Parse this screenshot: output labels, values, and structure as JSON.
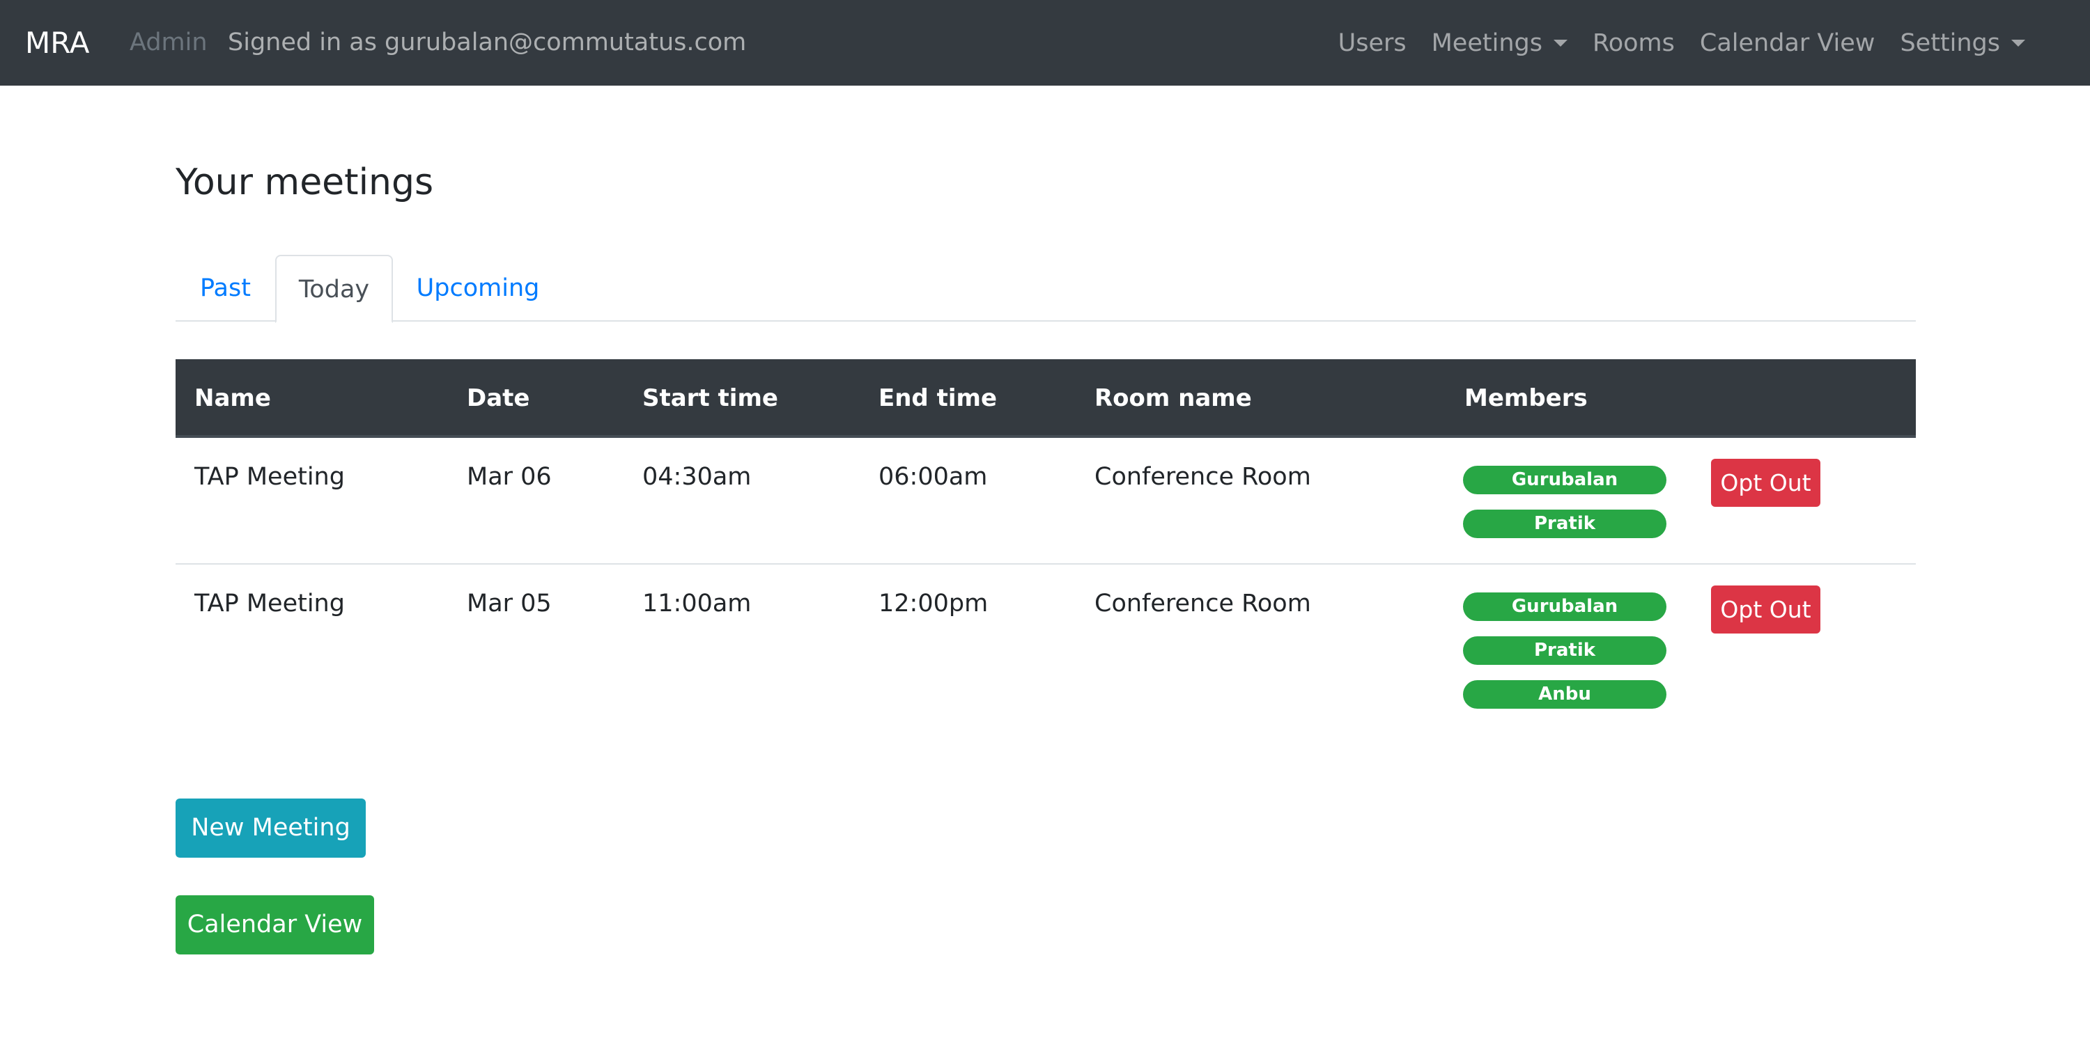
{
  "navbar": {
    "brand": "MRA",
    "admin_label": "Admin",
    "signed_in": "Signed in as gurubalan@commutatus.com",
    "links": {
      "users": "Users",
      "meetings": "Meetings",
      "rooms": "Rooms",
      "calendar_view": "Calendar View",
      "settings": "Settings"
    }
  },
  "page": {
    "title": "Your meetings"
  },
  "tabs": {
    "past": "Past",
    "today": "Today",
    "upcoming": "Upcoming",
    "active": "Today"
  },
  "table": {
    "headers": {
      "name": "Name",
      "date": "Date",
      "start": "Start time",
      "end": "End time",
      "room": "Room name",
      "members": "Members"
    },
    "rows": [
      {
        "name": "TAP Meeting",
        "date": "Mar 06",
        "start": "04:30am",
        "end": "06:00am",
        "room": "Conference Room",
        "members": [
          "Gurubalan",
          "Pratik"
        ],
        "action": "Opt Out"
      },
      {
        "name": "TAP Meeting",
        "date": "Mar 05",
        "start": "11:00am",
        "end": "12:00pm",
        "room": "Conference Room",
        "members": [
          "Gurubalan",
          "Pratik",
          "Anbu"
        ],
        "action": "Opt Out"
      }
    ]
  },
  "buttons": {
    "new_meeting": "New Meeting",
    "calendar_view": "Calendar View"
  },
  "colors": {
    "navbar_bg": "#343a40",
    "link_blue": "#007bff",
    "badge_green": "#28a745",
    "danger_red": "#dc3545",
    "info_teal": "#17a2b8"
  },
  "icons": {
    "dropdown": "chevron-down-icon"
  }
}
